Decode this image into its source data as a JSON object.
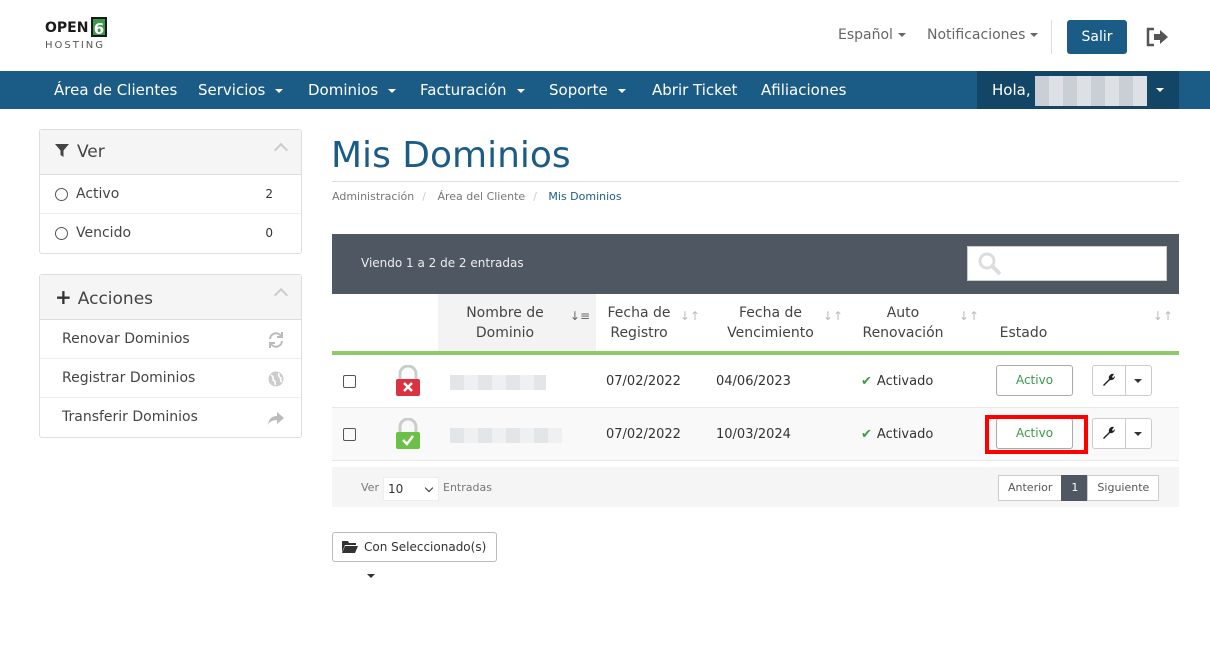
{
  "logo": {
    "line1": "OPEN",
    "digit": "6",
    "line2": "HOSTING"
  },
  "header": {
    "language": "Español",
    "notifications": "Notificaciones",
    "logout_button": "Salir"
  },
  "nav": {
    "items": [
      "Área de Clientes",
      "Servicios",
      "Dominios",
      "Facturación",
      "Soporte",
      "Abrir Ticket",
      "Afiliaciones"
    ],
    "greeting": "Hola, N"
  },
  "sidebar": {
    "ver": {
      "title": "Ver",
      "items": [
        {
          "label": "Activo",
          "count": "2"
        },
        {
          "label": "Vencido",
          "count": "0"
        }
      ]
    },
    "acciones": {
      "title": "Acciones",
      "items": [
        {
          "label": "Renovar Dominios",
          "icon": "refresh-icon"
        },
        {
          "label": "Registrar Dominios",
          "icon": "globe-icon"
        },
        {
          "label": "Transferir Dominios",
          "icon": "share-icon"
        }
      ]
    }
  },
  "page": {
    "title": "Mis Dominios"
  },
  "breadcrumb": [
    "Administración",
    "Área del Cliente",
    "Mis Dominios"
  ],
  "table": {
    "info": "Viendo 1 a 2 de 2 entradas",
    "columns": [
      "Nombre de Dominio",
      "Fecha de Registro",
      "Fecha de Vencimiento",
      "Auto Renovación",
      "Estado"
    ],
    "rows": [
      {
        "registro": "07/02/2022",
        "vencimiento": "04/06/2023",
        "auto": "Activado",
        "estado": "Activo",
        "ssl": "inactive"
      },
      {
        "registro": "07/02/2022",
        "vencimiento": "10/03/2024",
        "auto": "Activado",
        "estado": "Activo",
        "ssl": "active"
      }
    ],
    "footer": {
      "show_label": "Ver",
      "page_size": "10",
      "entries_label": "Entradas",
      "prev": "Anterior",
      "current": "1",
      "next": "Siguiente"
    }
  },
  "bulk_button": "Con Seleccionado(s)",
  "colors": {
    "brand": "#1b5c86",
    "accent_green": "#8ec96a",
    "highlight": "#ff0000"
  }
}
